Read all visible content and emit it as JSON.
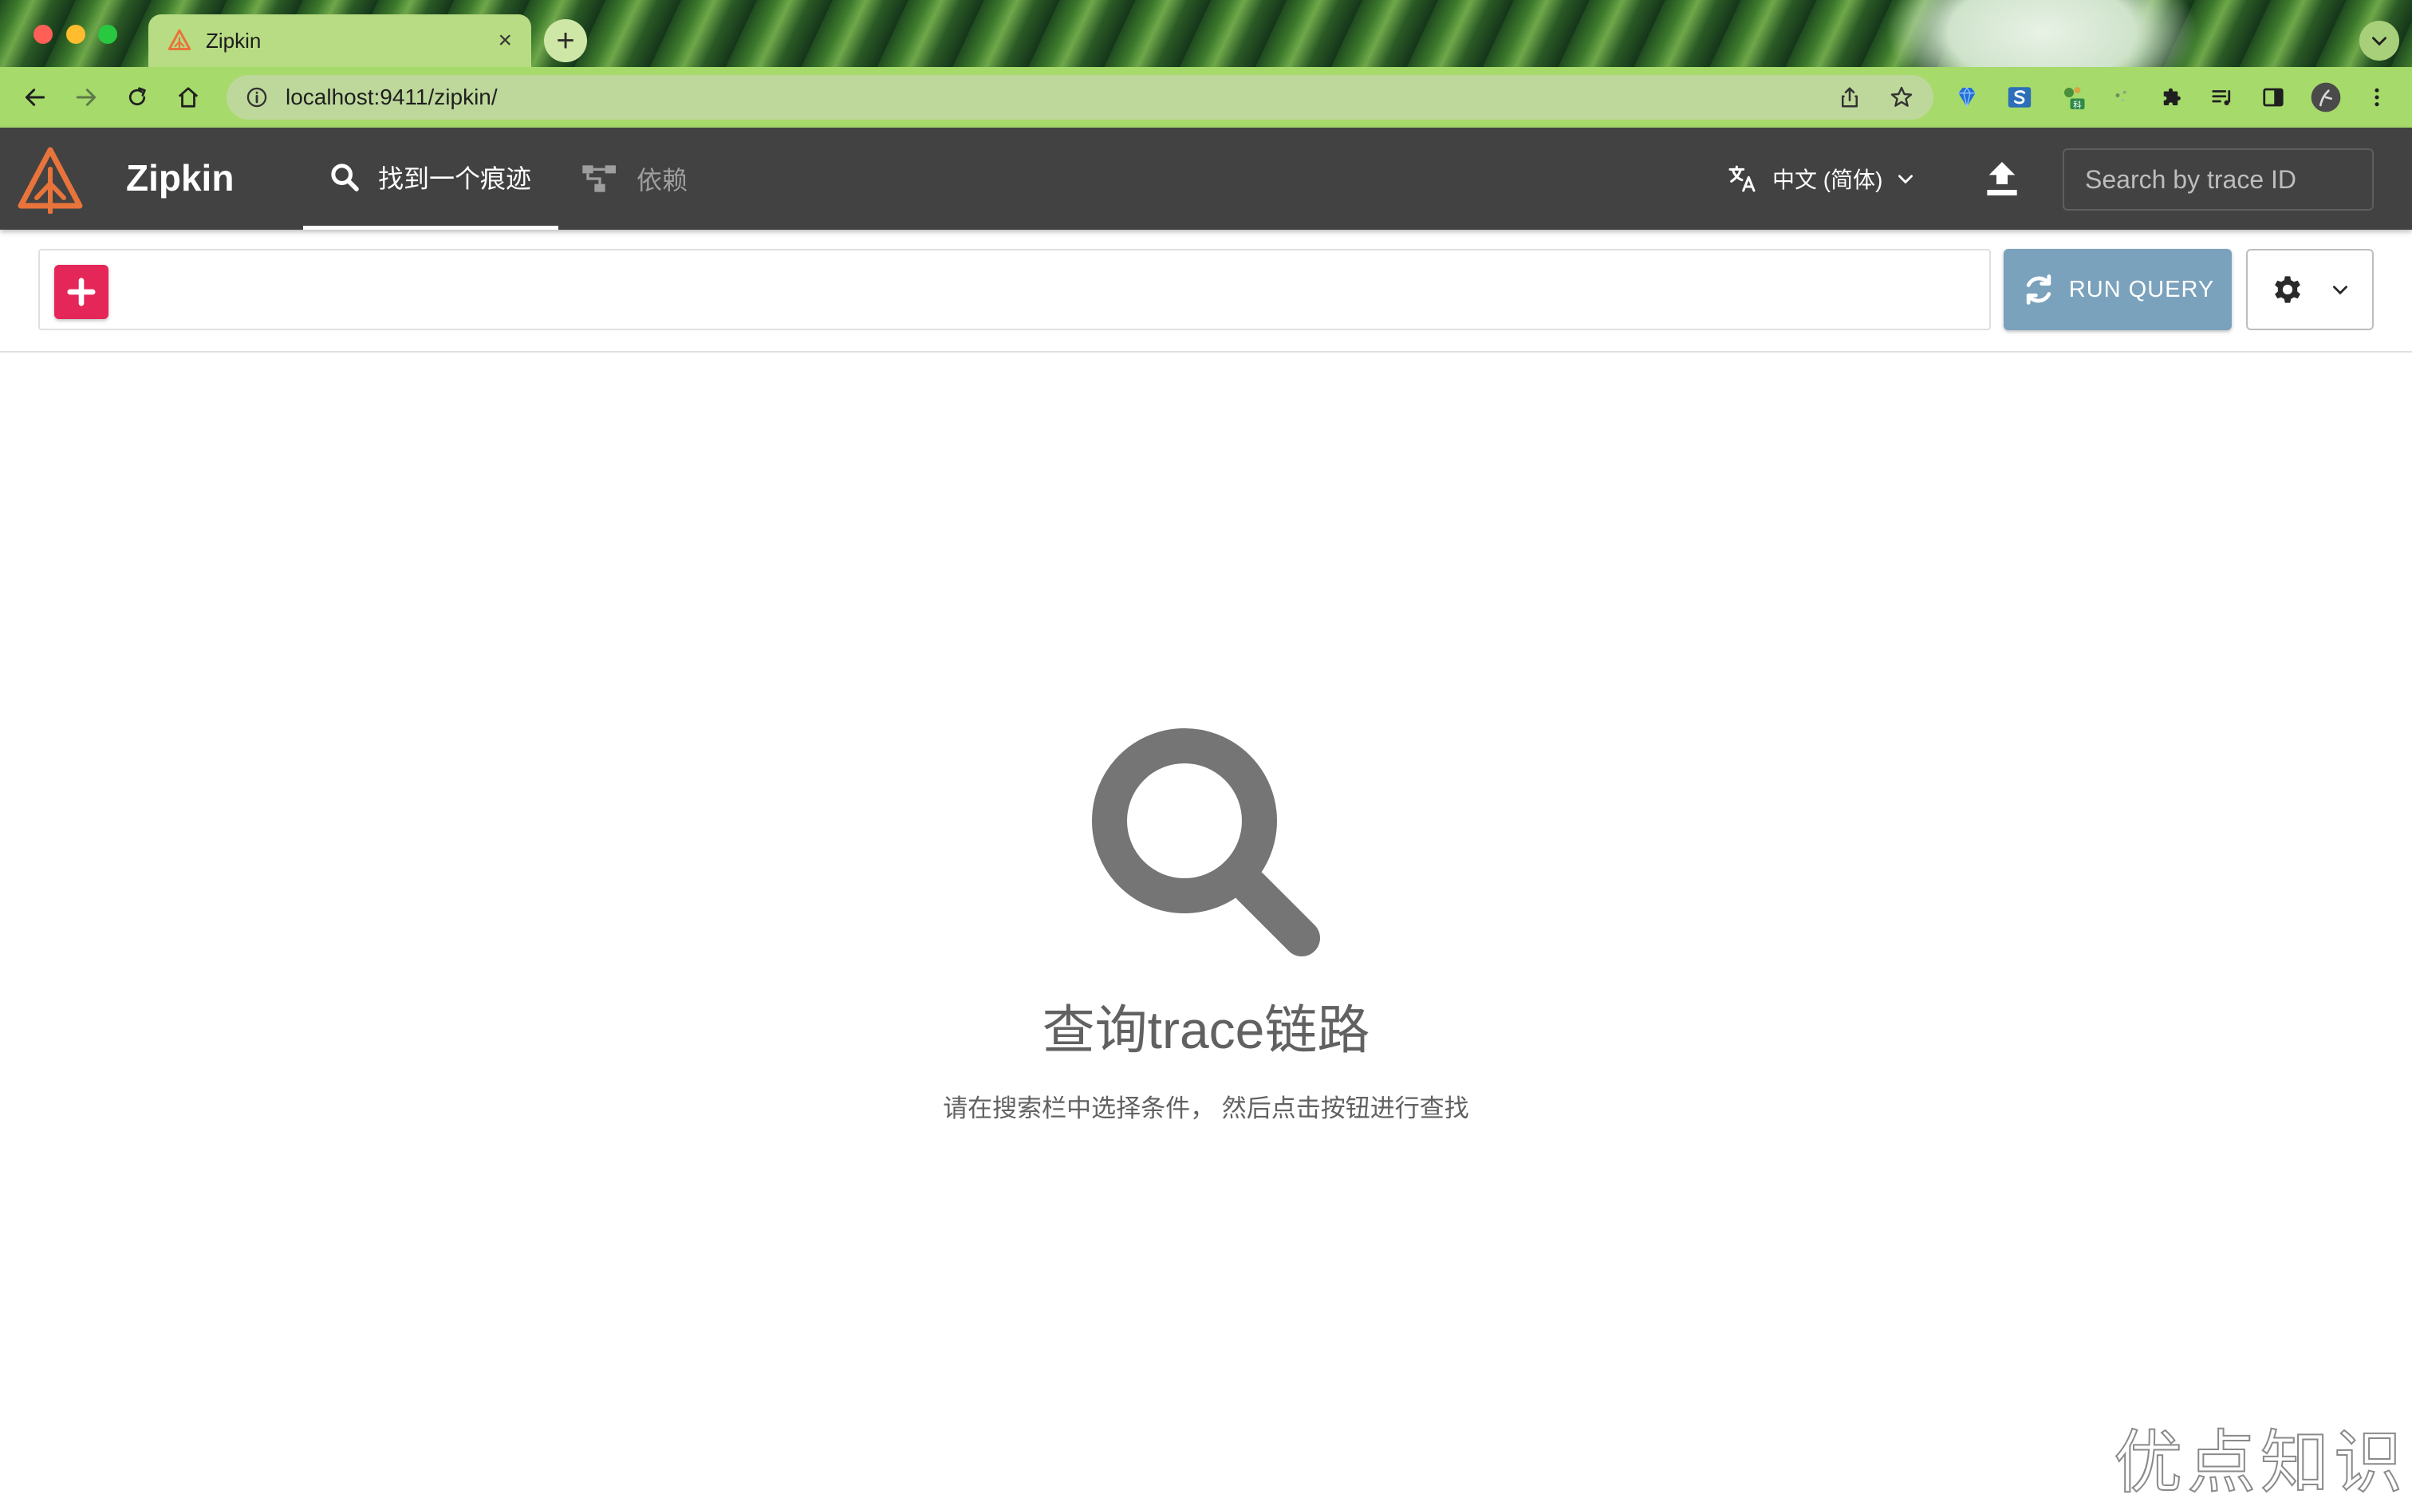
{
  "browser": {
    "tab_title": "Zipkin",
    "tab_close": "×",
    "new_tab": "+",
    "url": "localhost:9411/zipkin/",
    "profile_badge": "科"
  },
  "app": {
    "brand": "Zipkin",
    "nav": {
      "find_trace": "找到一个痕迹",
      "dependencies": "依赖"
    },
    "language": "中文 (简体)",
    "trace_search_placeholder": "Search by trace ID"
  },
  "query": {
    "run_label": "RUN QUERY"
  },
  "empty_state": {
    "title": "查询trace链路",
    "subtitle": "请在搜索栏中选择条件， 然后点击按钮进行查找"
  },
  "watermark": "优点知识",
  "colors": {
    "appbar": "#424242",
    "add_button": "#e42658",
    "run_button": "#7ba2bc",
    "logo": "#e8743b",
    "empty_icon": "#757575"
  }
}
